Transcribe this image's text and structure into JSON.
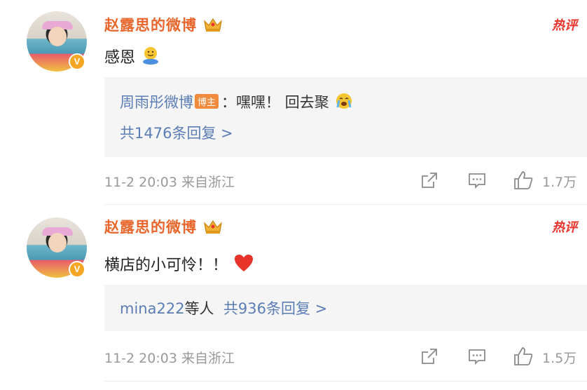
{
  "comments": [
    {
      "username": "赵露思的微博",
      "hot_label": "热评",
      "text": "感恩",
      "reply": {
        "author": "周雨彤微博",
        "author_badge": "博主",
        "text": "：嘿嘿！ 回去聚",
        "more": "共1476条回复 >"
      },
      "meta": "11-2 20:03 来自浙江",
      "likes": "1.7万"
    },
    {
      "username": "赵露思的微博",
      "hot_label": "热评",
      "text": "横店的小可怜！！",
      "reply": {
        "users": "mina222",
        "users_suffix": "等人",
        "more": "共936条回复 >"
      },
      "meta": "11-2 20:03 来自浙江",
      "likes": "1.5万"
    }
  ],
  "colors": {
    "username": "#e8662c",
    "link_blue": "#5b7db6",
    "hot_red": "#e8332a",
    "reply_bg": "#f5f5f5",
    "muted": "#999999"
  },
  "icons": [
    "crown-icon",
    "verified-badge-icon",
    "hugging-emoji-icon",
    "crying-emoji-icon",
    "heart-emoji-icon",
    "share-icon",
    "comment-icon",
    "like-icon"
  ]
}
